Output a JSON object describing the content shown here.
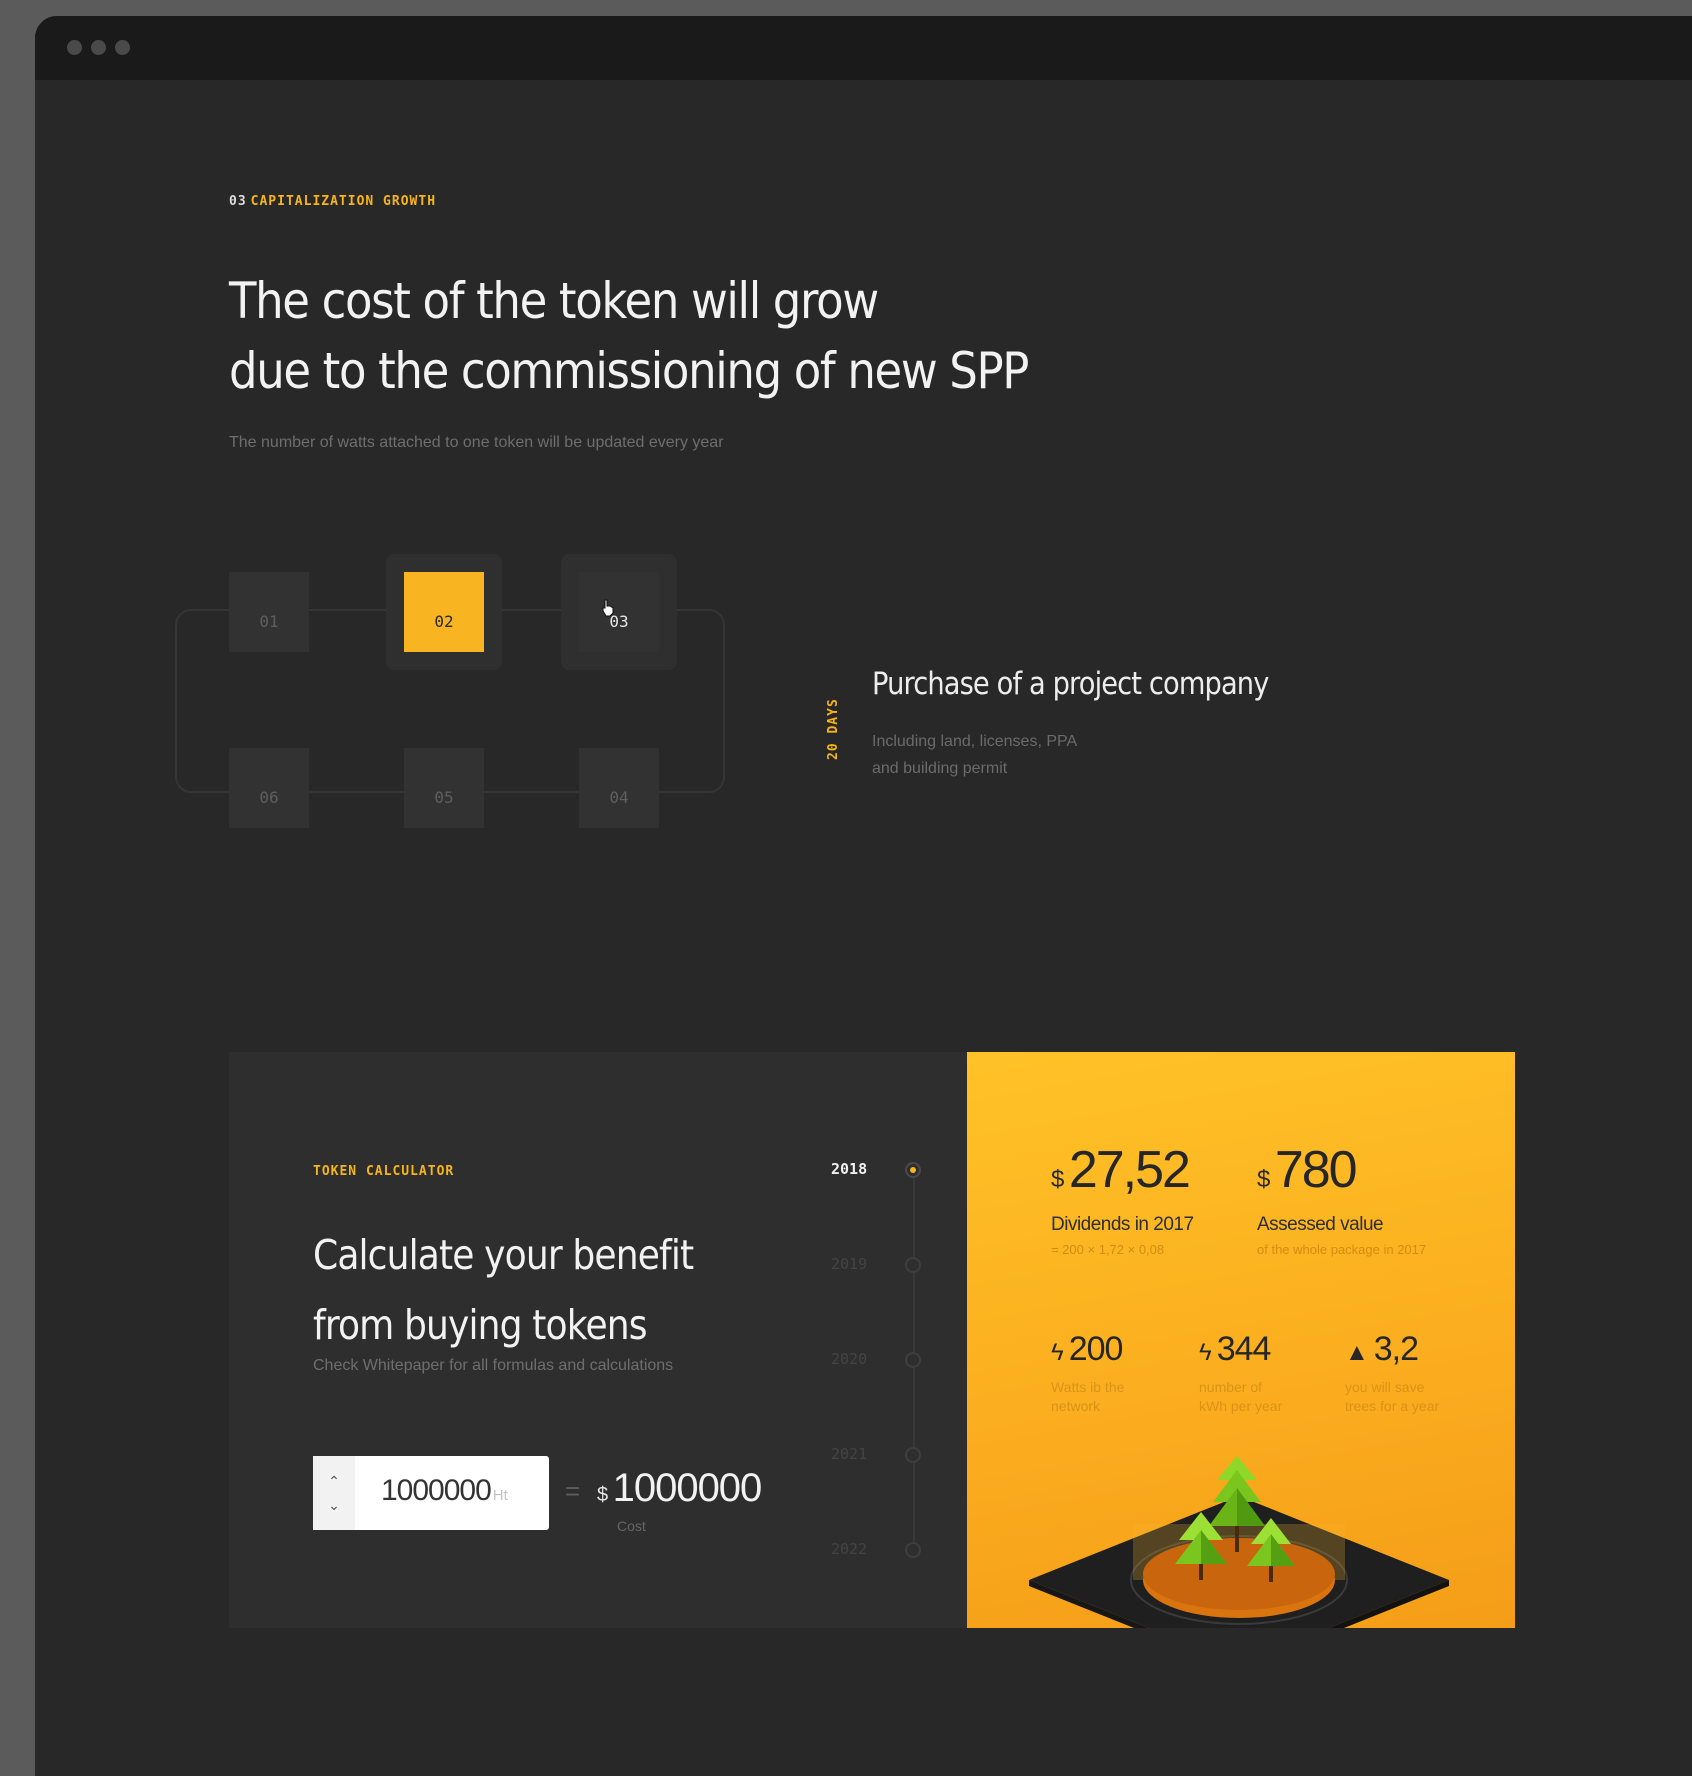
{
  "section": {
    "number": "03",
    "eyebrow": "CAPITALIZATION GROWTH",
    "title_line1": "The cost of the token will grow",
    "title_line2": "due to the commissioning of new SPP",
    "subtitle": "The number of watts attached to one token will be updated every year"
  },
  "steps": {
    "items": [
      "01",
      "02",
      "03",
      "04",
      "05",
      "06"
    ],
    "active": "02",
    "duration": "20 DAYS",
    "title": "Purchase of a project company",
    "desc_line1": "Including land, licenses, PPA",
    "desc_line2": "and building permit"
  },
  "calculator": {
    "eyebrow": "TOKEN CALCULATOR",
    "title_line1": "Calculate your benefit",
    "title_line2": "from buying tokens",
    "subtitle": "Check Whitepaper for all formulas and calculations",
    "input_value": "1000000",
    "input_unit": "Ht",
    "equals": "=",
    "cost_currency": "$",
    "cost_value": "1000000",
    "cost_label": "Cost",
    "years": [
      "2018",
      "2019",
      "2020",
      "2021",
      "2022"
    ],
    "active_year": "2018"
  },
  "results": {
    "dividends_currency": "$",
    "dividends_value": "27,52",
    "dividends_label": "Dividends in 2017",
    "dividends_formula": "= 200 × 1,72 × 0,08",
    "assessed_currency": "$",
    "assessed_value": "780",
    "assessed_label": "Assessed value",
    "assessed_sub": "of the whole package in 2017",
    "watts_value": "200",
    "watts_label_line1": "Watts ib the",
    "watts_label_line2": "network",
    "kwh_value": "344",
    "kwh_label_line1": "number of",
    "kwh_label_line2": "kWh per year",
    "trees_value": "3,2",
    "trees_label_line1": "you will save",
    "trees_label_line2": "trees for a year"
  },
  "icons": {
    "bolt": "lightning-icon",
    "tree": "tree-icon",
    "up": "chevron-up-icon",
    "down": "chevron-down-icon"
  },
  "colors": {
    "accent": "#f9b421",
    "background": "#282828",
    "panel": "#2e2e2e"
  }
}
